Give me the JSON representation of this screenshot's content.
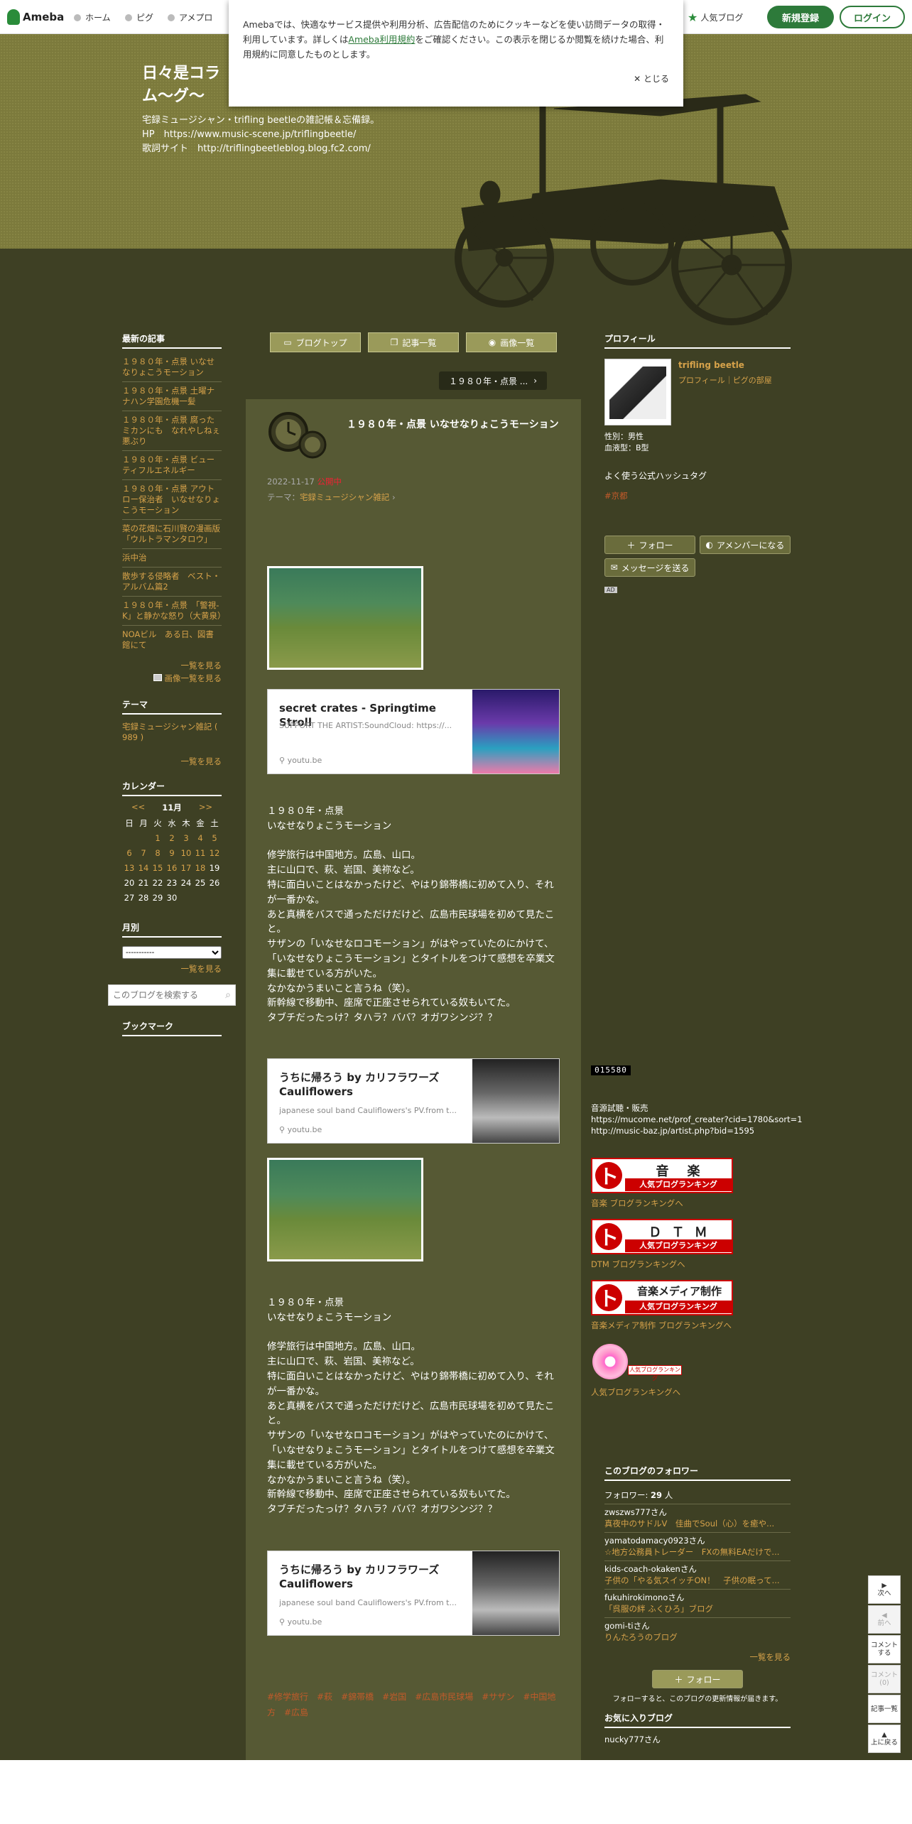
{
  "topbar": {
    "logo": "Ameba",
    "nav": [
      "ホーム",
      "ピグ",
      "アメプロ"
    ],
    "popular": "人気ブログ",
    "signup": "新規登録",
    "login": "ログイン"
  },
  "cookie": {
    "text1": "Amebaでは、快適なサービス提供や利用分析、広告配信のためにクッキーなどを使い訪問データの取得・利用しています。詳しくは",
    "link": "Ameba利用規約",
    "text2": "をご確認ください。この表示を閉じるか閲覧を続けた場合、利用規約に同意したものとします。",
    "close": "とじる"
  },
  "header": {
    "title": "日々是コラム～グ～",
    "desc1": "宅録ミュージシャン・trifling beetleの雑記帳＆忘備録。",
    "desc2": "HP　https://www.music-scene.jp/triflingbeetle/",
    "desc3": "歌詞サイト　http://triflingbeetleblog.blog.fc2.com/"
  },
  "left": {
    "recent_title": "最新の記事",
    "recent": [
      "１９８０年・点景 いなせなりょこうモーション",
      "１９８０年・点景 土曜ナナハン学園危機一髪",
      "１９８０年・点景 腐ったミカンにも　なれやしねぇ　悪ぶり",
      "１９８０年・点景 ビューティフルエネルギー",
      "１９８０年・点景 アウトロー保治者　いなせなりょこうモーション",
      "菜の花畑に石川賢の漫画版「ウルトラマンタロウ」",
      "浜中治",
      "散歩する侵略者　ベスト・アルバム篇2",
      "１９８０年・点景　「警視-K」と静かな怒り（大黄泉）",
      "NOAビル　ある日、図書館にて"
    ],
    "more1": "一覧を見る",
    "more2": "画像一覧を見る",
    "theme_title": "テーマ",
    "theme": "宅録ミュージシャン雑記 ( 989 )",
    "more3": "一覧を見る",
    "cal_title": "カレンダー",
    "cal_prev": "<<",
    "cal_month": "11月",
    "cal_next": ">>",
    "cal_head": [
      "日",
      "月",
      "火",
      "水",
      "木",
      "金",
      "土"
    ],
    "cal_rows": [
      [
        "",
        "",
        "1",
        "2",
        "3",
        "4",
        "5"
      ],
      [
        "6",
        "7",
        "8",
        "9",
        "10",
        "11",
        "12"
      ],
      [
        "13",
        "14",
        "15",
        "16",
        "17",
        "18",
        "19"
      ],
      [
        "20",
        "21",
        "22",
        "23",
        "24",
        "25",
        "26"
      ],
      [
        "27",
        "28",
        "29",
        "30",
        "",
        "",
        ""
      ]
    ],
    "month_title": "月別",
    "month_select": "-----------",
    "more4": "一覧を見る",
    "search_placeholder": "このブログを検索する",
    "bookmark_title": "ブックマーク"
  },
  "tabs": [
    "ブログトップ",
    "記事一覧",
    "画像一覧"
  ],
  "pager": "１９８０年・点景 ...",
  "article": {
    "title": "１９８０年・点景 いなせなりょこうモーション",
    "date": "2022-11-17",
    "status": "公開中",
    "theme_label": "テーマ：",
    "theme": "宅録ミュージシャン雑記",
    "card1": {
      "title": "secret crates - Springtime Stroll",
      "desc": "SUPPORT THE ARTIST:SoundCloud: https://...",
      "url": "youtu.be"
    },
    "card2": {
      "title": "うちに帰ろう by カリフラワーズ Cauliflowers",
      "desc": "japanese soul band Cauliflowers's PV.from t...",
      "url": "youtu.be"
    },
    "body": [
      "１９８０年・点景",
      "いなせなりょこうモーション",
      "",
      "修学旅行は中国地方。広島、山口。",
      "主に山口で、萩、岩国、美祢など。",
      "特に面白いことはなかったけど、やはり錦帯橋に初めて入り、それが一番かな。",
      "あと真横をバスで通っただけだけど、広島市民球場を初めて見たこと。",
      "サザンの「いなせなロコモーション」がはやっていたのにかけて、「いなせなりょこうモーション」とタイトルをつけて感想を卒業文集に載せている方がいた。",
      "なかなかうまいこと言うね（笑）。",
      "新幹線で移動中、座席で正座させられている奴もいてた。",
      "タブチだったっけ？タハラ？ババ？オガワシンジ？？"
    ],
    "hashtags": "#修学旅行　#萩　#錦帯橋　#岩国　#広島市民球場　#サザン　#中国地方　#広島"
  },
  "right": {
    "profile_title": "プロフィール",
    "name": "trifling beetle",
    "prof_links": "プロフィール｜ピグの部屋",
    "gender": "性別：男性",
    "blood": "血液型：B型",
    "hashtag_title": "よく使う公式ハッシュタグ",
    "hashtag": "#京都",
    "follow": "フォロー",
    "member": "アメンバーになる",
    "message": "メッセージを送る",
    "ad": "AD",
    "counter": "015580",
    "sales": "音源試聴・販売",
    "sales_url1": "https://mucome.net/prof_creater?cid=1780&sort=1",
    "sales_url2": "http://music-baz.jp/artist.php?bid=1595",
    "ranks": [
      {
        "t1": "音　楽",
        "t2": "人気ブログランキング",
        "link": "音楽 ブログランキングへ"
      },
      {
        "t1": "Ｄ Ｔ Ｍ",
        "t2": "人気ブログランキング",
        "link": "DTM ブログランキングへ"
      },
      {
        "t1": "音楽メディア制作",
        "t2": "人気ブログランキング",
        "link": "音楽メディア制作 ブログランキングへ"
      }
    ],
    "rank4_label": "人気ブログランキング",
    "rank4_link": "人気ブログランキングへ",
    "followers_title": "このブログのフォロワー",
    "followers_count_label": "フォロワー:",
    "followers_count": "29",
    "followers_unit": "人",
    "followers": [
      {
        "name": "zwszws777さん",
        "blog": "真夜中のサドルV　佳曲でSoul（心）を癒や..."
      },
      {
        "name": "yamatodamacy0923さん",
        "blog": "☆地方公務員トレーダー　FXの無料EAだけで..."
      },
      {
        "name": "kids-coach-okakenさん",
        "blog": "子供の「やる気スイッチON！　子供の眠って..."
      },
      {
        "name": "fukuhirokimonoさん",
        "blog": "「呉服の絆 ふくひろ」ブログ"
      },
      {
        "name": "gomi-tiさん",
        "blog": "りんたろうのブログ"
      }
    ],
    "more": "一覧を見る",
    "follow2": "フォロー",
    "follow_note": "フォローすると、このブログの更新情報が届きます。",
    "fav_title": "お気に入りブログ",
    "fav1": "nucky777さん"
  },
  "floatnav": [
    "次へ",
    "前へ",
    "コメントする",
    "コメント(0)",
    "記事一覧",
    "上に戻る"
  ]
}
